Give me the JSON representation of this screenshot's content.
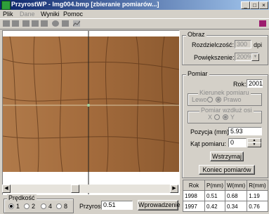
{
  "window": {
    "title": "PrzyrostWP - Img004.bmp [zbieranie pomiarów...]"
  },
  "menu": [
    {
      "label": "Plik",
      "disabled": false
    },
    {
      "label": "Dane",
      "disabled": true
    },
    {
      "label": "Wyniki",
      "disabled": false
    },
    {
      "label": "Pomoc",
      "disabled": false
    }
  ],
  "obraz": {
    "title": "Obraz",
    "resolution_label": "Rozdzielczość:",
    "resolution_value": "300",
    "resolution_unit": "dpi",
    "zoom_label": "Powiększenie:",
    "zoom_value": "200%"
  },
  "pomiar": {
    "title": "Pomiar",
    "year_label": "Rok:",
    "year_value": "2001",
    "direction_title": "Kierunek pomiaru",
    "direction_left": "Lewo",
    "direction_right": "Prawo",
    "axis_title": "Pomiar wzdłuż osi",
    "axis_x": "X",
    "axis_y": "Y",
    "position_label": "Pozycja (mm):",
    "position_value": "5.93",
    "angle_label": "Kąt pomiaru:",
    "angle_value": "0",
    "pause_button": "Wstrzymaj",
    "end_button": "Koniec pomiarów"
  },
  "results_table": {
    "headers": [
      "Rok",
      "P(mm)",
      "W(mm)",
      "R(mm)"
    ],
    "rows": [
      [
        "1998",
        "0.51",
        "0.68",
        "1.19"
      ],
      [
        "1997",
        "0.42",
        "0.34",
        "0.76"
      ]
    ]
  },
  "speed": {
    "title": "Prędkość",
    "options": [
      "1",
      "2",
      "4",
      "8"
    ],
    "selected": "1"
  },
  "przyrost": {
    "label": "Przyrost",
    "value": "0.51",
    "enter_button": "Wprowadzenie"
  },
  "icons": [
    "app-icon",
    "minimize-icon",
    "maximize-icon",
    "close-icon",
    "book-icon"
  ]
}
